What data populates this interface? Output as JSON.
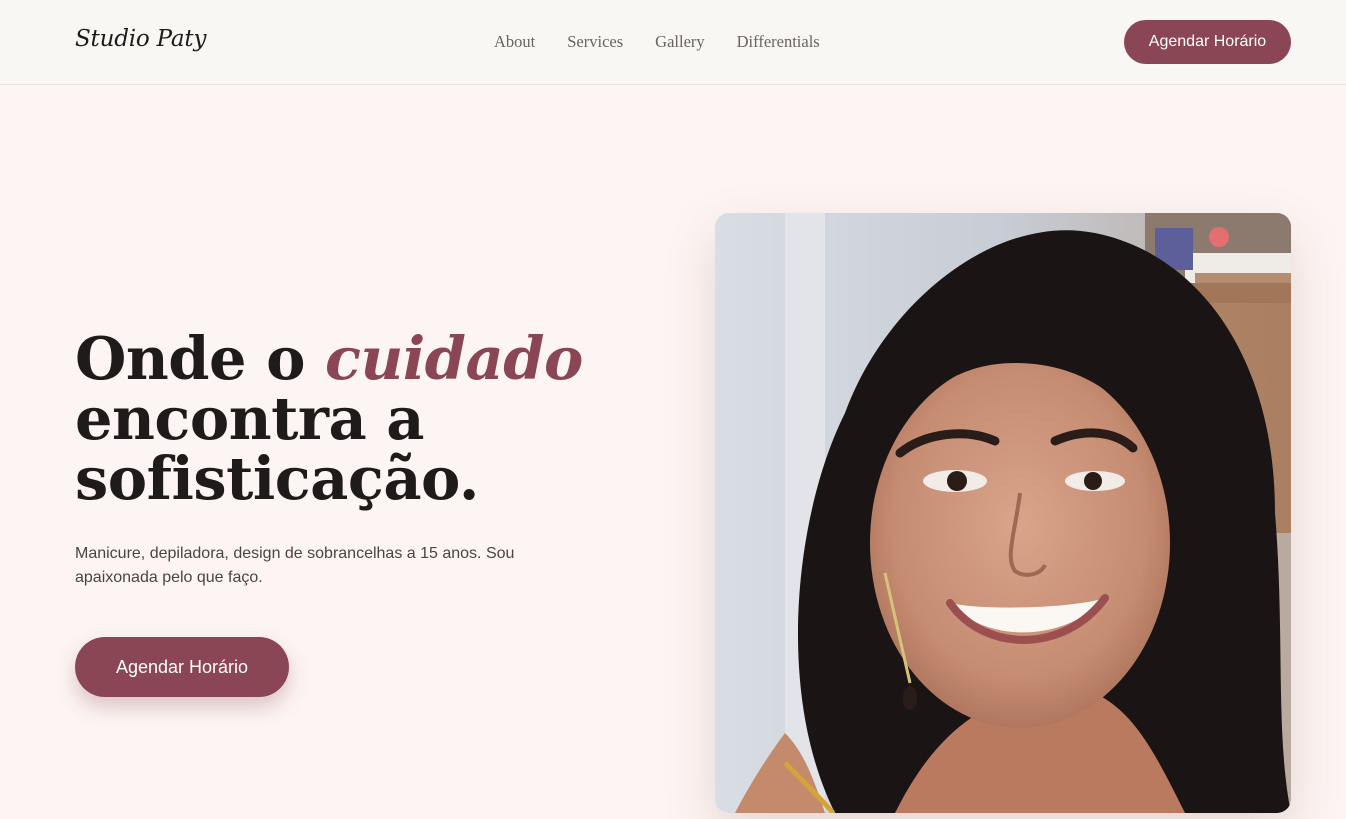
{
  "brand": "Studio Paty",
  "nav": {
    "items": [
      {
        "label": "About"
      },
      {
        "label": "Services"
      },
      {
        "label": "Gallery"
      },
      {
        "label": "Differentials"
      }
    ],
    "cta_label": "Agendar Horário"
  },
  "hero": {
    "title_part1": "Onde o ",
    "title_accent": "cuidado",
    "title_part2": "encontra a",
    "title_part3": "sofisticação.",
    "subtitle": "Manicure, depiladora, design de sobrancelhas a 15 anos. Sou apaixonada pelo que faço.",
    "cta_label": "Agendar Horário"
  },
  "colors": {
    "accent": "#8a4654",
    "background": "#fdf5f3",
    "nav_background": "#f8f7f4",
    "text": "#1f1b1a"
  }
}
